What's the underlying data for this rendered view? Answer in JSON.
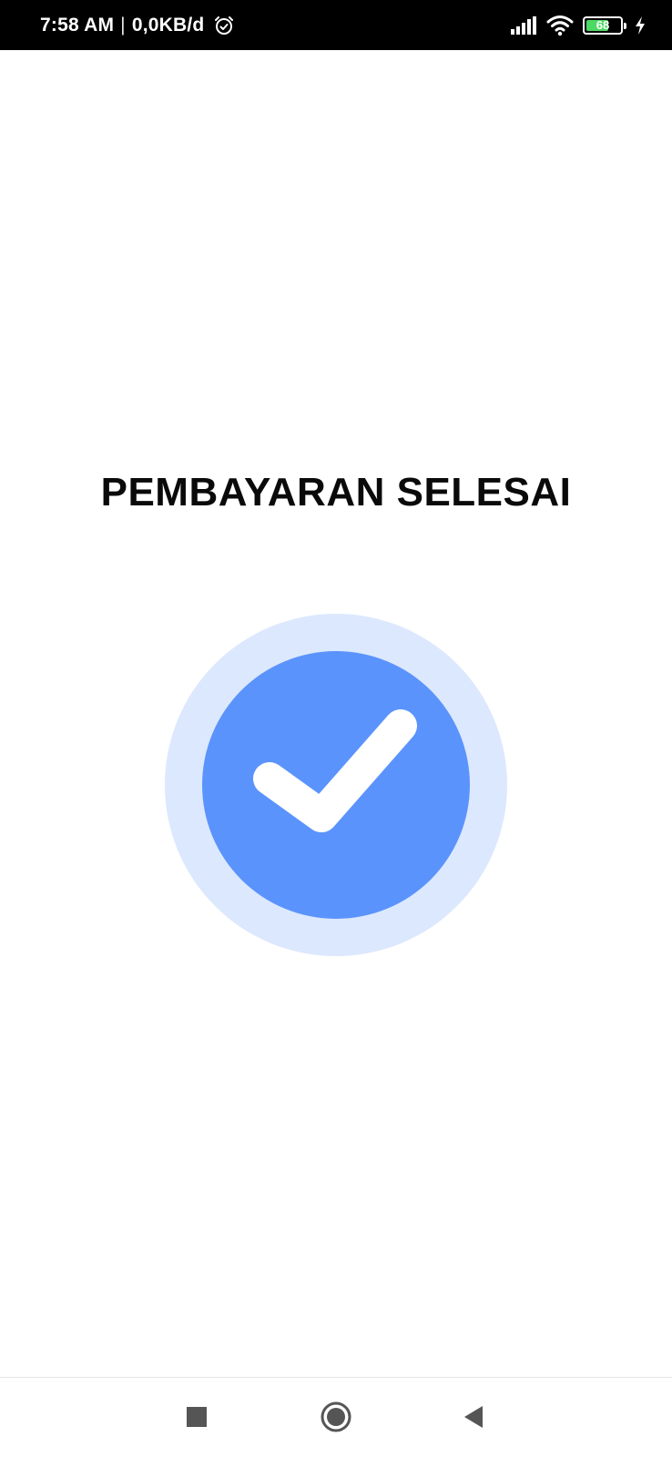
{
  "status_bar": {
    "time": "7:58 AM",
    "separator": "|",
    "network_speed": "0,0KB/d",
    "alarm_icon": "alarm-clock-icon",
    "signal_icon": "cellular-signal-icon",
    "wifi_icon": "wifi-icon",
    "battery_level": "68",
    "charging_icon": "charging-bolt-icon"
  },
  "main": {
    "title": "PEMBAYARAN SELESAI",
    "status_icon": "checkmark-circle-icon",
    "colors": {
      "outer_ring": "#dce8fd",
      "inner_circle": "#5b93fd",
      "checkmark": "#ffffff",
      "title_text": "#0a0a0a"
    }
  },
  "nav_bar": {
    "recents_icon": "square-recents-icon",
    "home_icon": "circle-home-icon",
    "back_icon": "triangle-back-icon"
  }
}
